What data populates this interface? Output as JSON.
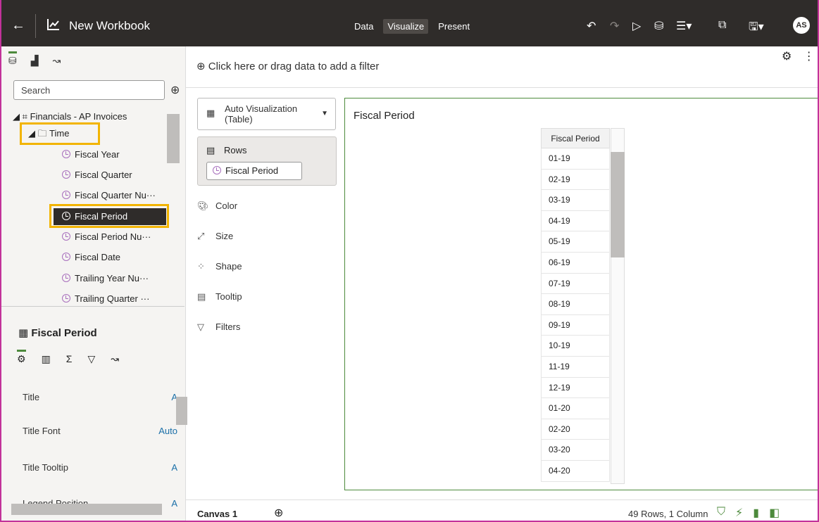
{
  "header": {
    "workbook_title": "New Workbook",
    "tabs": [
      {
        "label": "Data",
        "active": false
      },
      {
        "label": "Visualize",
        "active": true
      },
      {
        "label": "Present",
        "active": false
      }
    ],
    "avatar_initials": "AS"
  },
  "left_panel": {
    "search_placeholder": "Search",
    "tree": {
      "subject_area": "Financials - AP Invoices",
      "folder": "Time",
      "items": [
        "Fiscal Year",
        "Fiscal Quarter",
        "Fiscal Quarter Nu···",
        "Fiscal Period",
        "Fiscal Period Nu···",
        "Fiscal Date",
        "Trailing Year Nu···",
        "Trailing Quarter ···"
      ],
      "selected_item": "Fiscal Period"
    },
    "properties": {
      "title": "Fiscal Period",
      "rows": [
        {
          "label": "Title",
          "value": "A"
        },
        {
          "label": "Title Font",
          "value": "Auto"
        },
        {
          "label": "Title Tooltip",
          "value": "A"
        },
        {
          "label": "Legend Position",
          "value": "A"
        }
      ]
    }
  },
  "filter_bar": {
    "text": "Click here or drag data to add a filter"
  },
  "grammar": {
    "viz_type_line1": "Auto Visualization",
    "viz_type_line2": "(Table)",
    "rows_label": "Rows",
    "rows_pill": "Fiscal Period",
    "color": "Color",
    "size": "Size",
    "shape": "Shape",
    "tooltip": "Tooltip",
    "filters": "Filters"
  },
  "canvas": {
    "title": "Fiscal Period",
    "table_header": "Fiscal Period",
    "table_rows": [
      "01-19",
      "02-19",
      "03-19",
      "04-19",
      "05-19",
      "06-19",
      "07-19",
      "08-19",
      "09-19",
      "10-19",
      "11-19",
      "12-19",
      "01-20",
      "02-20",
      "03-20",
      "04-20"
    ]
  },
  "footer": {
    "canvas_tab": "Canvas 1",
    "status": "49 Rows, 1 Column"
  },
  "colors": {
    "highlight": "#f2b400",
    "accent": "#4d8a3c",
    "topbar": "#2f2c2a"
  }
}
